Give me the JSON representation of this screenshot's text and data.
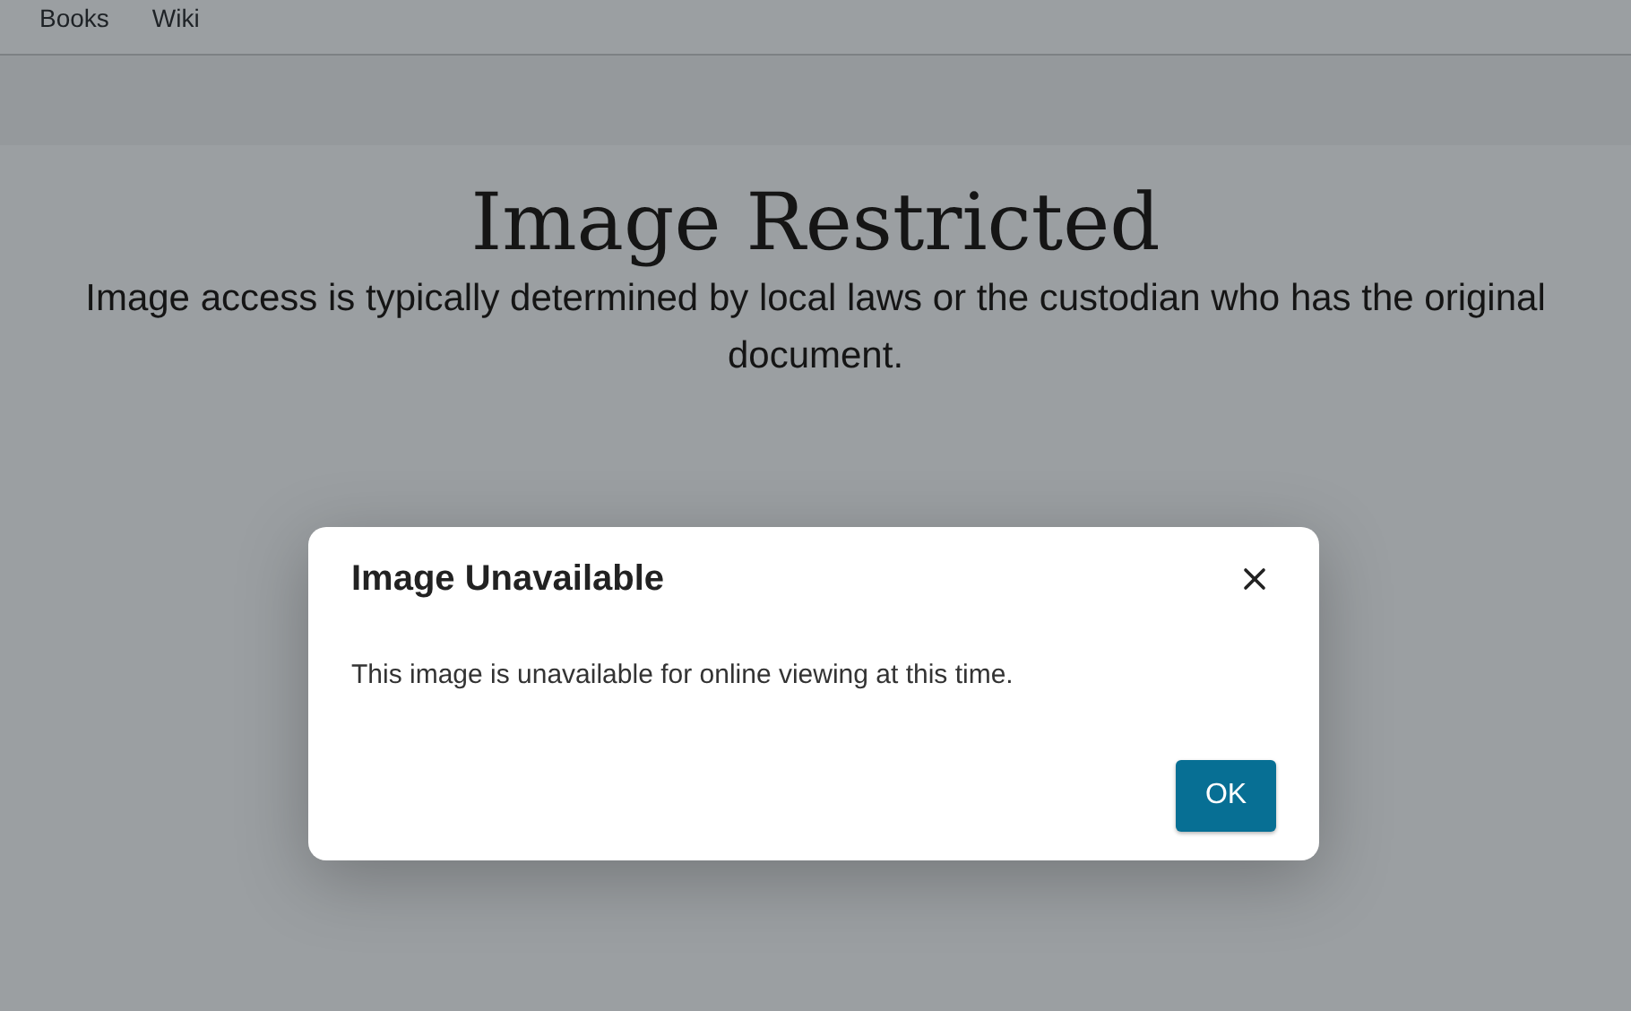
{
  "nav": {
    "links": [
      "Books",
      "Wiki"
    ]
  },
  "page": {
    "title": "Image Restricted",
    "description": "Image access is typically determined by local laws or the custodian who has the original document."
  },
  "dialog": {
    "title": "Image Unavailable",
    "message": "This image is unavailable for online viewing at this time.",
    "button": "OK"
  }
}
